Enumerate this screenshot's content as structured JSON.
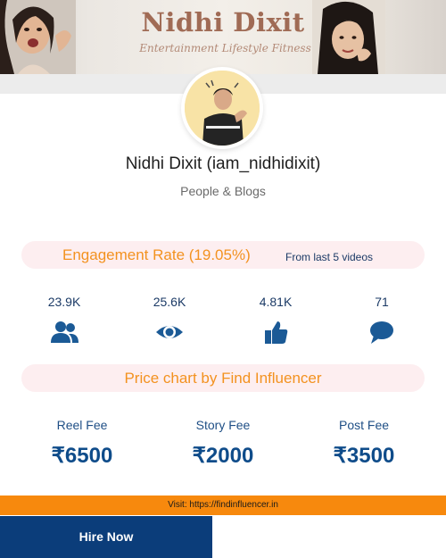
{
  "banner": {
    "title": "Nidhi Dixit",
    "subtitle": "Entertainment Lifestyle Fitness"
  },
  "profile": {
    "name": "Nidhi Dixit (iam_nidhidixit)",
    "category": "People & Blogs"
  },
  "engagement": {
    "label": "Engagement Rate (19.05%)",
    "note": "From last 5 videos"
  },
  "stats": [
    {
      "value": "23.9K",
      "icon": "followers-icon"
    },
    {
      "value": "25.6K",
      "icon": "views-icon"
    },
    {
      "value": "4.81K",
      "icon": "likes-icon"
    },
    {
      "value": "71",
      "icon": "comments-icon"
    }
  ],
  "price_chart": {
    "title": "Price chart by Find Influencer",
    "fees": [
      {
        "label": "Reel Fee",
        "value": "₹6500"
      },
      {
        "label": "Story Fee",
        "value": "₹2000"
      },
      {
        "label": "Post Fee",
        "value": "₹3500"
      }
    ]
  },
  "footer": {
    "visit": "Visit: https://findinfluencer.in",
    "hire": "Hire Now"
  },
  "colors": {
    "accent_orange": "#f39220",
    "brand_blue": "#0b3d7a",
    "pill_bg": "#fdeef0"
  }
}
